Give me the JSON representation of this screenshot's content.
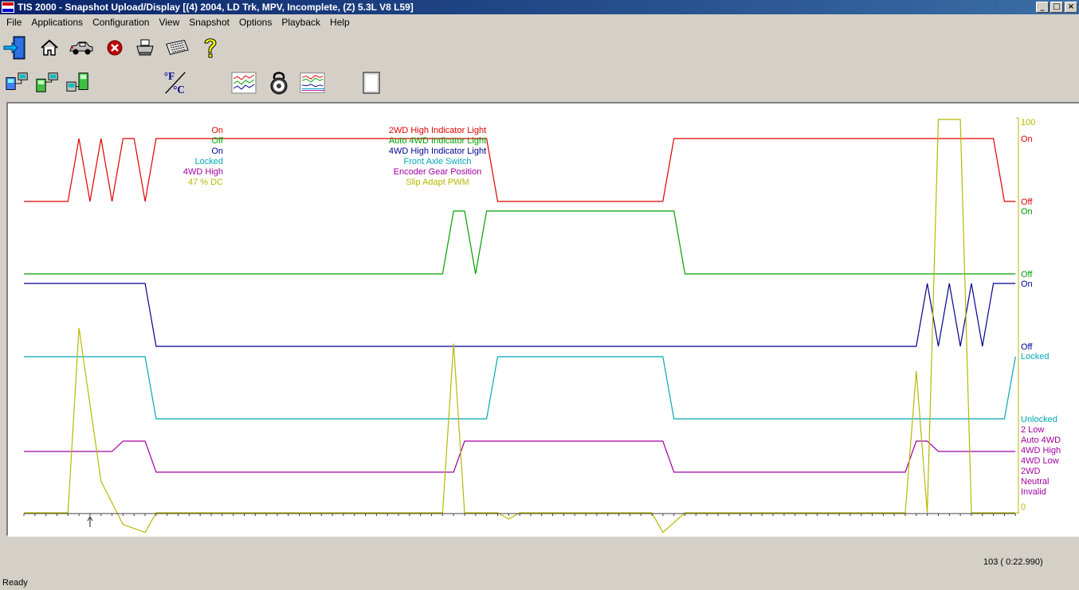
{
  "window": {
    "title": "TIS 2000 - Snapshot Upload/Display [(4) 2004, LD Trk, MPV, Incomplete, (Z) 5.3L   V8 L59]",
    "min_glyph": "_",
    "max_glyph": "□",
    "close_glyph": "×"
  },
  "menu": [
    "File",
    "Applications",
    "Configuration",
    "View",
    "Snapshot",
    "Options",
    "Playback",
    "Help"
  ],
  "toolbar_row1": [
    {
      "icon": "exit-door-icon"
    },
    {
      "icon": "home-icon"
    },
    {
      "icon": "vehicle-icon"
    },
    {
      "icon": "stop-icon"
    },
    {
      "icon": "print-icon"
    },
    {
      "icon": "keyboard-icon"
    },
    {
      "icon": "help-icon"
    }
  ],
  "toolbar_row2": [
    {
      "icon": "upload-device-icon"
    },
    {
      "icon": "transfer-device-icon"
    },
    {
      "icon": "download-device-icon"
    },
    {
      "icon": "unit-toggle-icon",
      "label_top": "°F",
      "label_bottom": "°C"
    },
    {
      "icon": "graph-icon"
    },
    {
      "icon": "lock-dial-icon"
    },
    {
      "icon": "graph-overlay-icon"
    },
    {
      "icon": "page-icon"
    }
  ],
  "colors": {
    "red": "#e00000",
    "green": "#00a000",
    "blue": "#000090",
    "cyan": "#00a8b8",
    "purple": "#a000a0",
    "olive": "#b8b800",
    "tick": "#404040"
  },
  "chart_data": {
    "type": "line",
    "x_samples": 46,
    "cursor_sample": 3,
    "current_values": [
      {
        "text": "On",
        "color": "red"
      },
      {
        "text": "Off",
        "color": "green"
      },
      {
        "text": "On",
        "color": "blue"
      },
      {
        "text": "Locked",
        "color": "cyan"
      },
      {
        "text": "4WD High",
        "color": "purple"
      },
      {
        "text": "47  % DC",
        "color": "olive"
      }
    ],
    "legend": [
      {
        "text": "2WD High Indicator Light",
        "color": "red"
      },
      {
        "text": "Auto 4WD Indicator Light",
        "color": "green"
      },
      {
        "text": "4WD High Indicator Light",
        "color": "blue"
      },
      {
        "text": "Front Axle Switch",
        "color": "cyan"
      },
      {
        "text": "Encoder Gear Position",
        "color": "purple"
      },
      {
        "text": "Slip Adapt PWM",
        "color": "olive"
      }
    ],
    "series": [
      {
        "name": "2WD High Indicator Light",
        "color": "red",
        "states": [
          "Off",
          "On"
        ],
        "points": [
          [
            0,
            0
          ],
          [
            2,
            0
          ],
          [
            2.5,
            1
          ],
          [
            3,
            0
          ],
          [
            3.5,
            1
          ],
          [
            4,
            0
          ],
          [
            4.5,
            1
          ],
          [
            5,
            1
          ],
          [
            5.5,
            0
          ],
          [
            6,
            1
          ],
          [
            21,
            1
          ],
          [
            21.5,
            0
          ],
          [
            29,
            0
          ],
          [
            29.5,
            1
          ],
          [
            44,
            1
          ],
          [
            44.5,
            0
          ],
          [
            45,
            0
          ]
        ]
      },
      {
        "name": "Auto 4WD Indicator Light",
        "color": "green",
        "states": [
          "Off",
          "On"
        ],
        "points": [
          [
            0,
            0
          ],
          [
            19,
            0
          ],
          [
            19.5,
            1
          ],
          [
            20,
            1
          ],
          [
            20.5,
            0
          ],
          [
            21,
            1
          ],
          [
            29.5,
            1
          ],
          [
            30,
            0
          ],
          [
            45,
            0
          ]
        ]
      },
      {
        "name": "4WD High Indicator Light",
        "color": "blue",
        "states": [
          "Off",
          "On"
        ],
        "points": [
          [
            0,
            1
          ],
          [
            5.5,
            1
          ],
          [
            6,
            0
          ],
          [
            40.5,
            0
          ],
          [
            41,
            1
          ],
          [
            41.5,
            0
          ],
          [
            42,
            1
          ],
          [
            42.5,
            0
          ],
          [
            43,
            1
          ],
          [
            43.5,
            0
          ],
          [
            44,
            1
          ],
          [
            45,
            1
          ]
        ]
      },
      {
        "name": "Front Axle Switch",
        "color": "cyan",
        "states": [
          "Unlocked",
          "Locked"
        ],
        "points": [
          [
            0,
            1
          ],
          [
            5.5,
            1
          ],
          [
            6,
            0
          ],
          [
            21,
            0
          ],
          [
            21.5,
            1
          ],
          [
            29,
            1
          ],
          [
            29.5,
            0
          ],
          [
            44.5,
            0
          ],
          [
            45,
            1
          ]
        ]
      },
      {
        "name": "Encoder Gear Position",
        "color": "purple",
        "states": [
          "Invalid",
          "Neutral",
          "2WD",
          "4WD Low",
          "4WD High",
          "Auto 4WD",
          "2 Low"
        ],
        "points": [
          [
            0,
            4
          ],
          [
            4,
            4
          ],
          [
            4.5,
            5
          ],
          [
            5.5,
            5
          ],
          [
            6,
            2
          ],
          [
            19.5,
            2
          ],
          [
            20,
            5
          ],
          [
            29,
            5
          ],
          [
            29.5,
            2
          ],
          [
            40,
            2
          ],
          [
            40.5,
            5
          ],
          [
            41,
            5
          ],
          [
            41.5,
            4
          ],
          [
            45,
            4
          ]
        ]
      },
      {
        "name": "Slip Adapt PWM",
        "color": "olive",
        "unit": "% DC",
        "ylim": [
          0,
          100
        ],
        "points": [
          [
            0,
            0
          ],
          [
            2,
            0
          ],
          [
            2.5,
            47
          ],
          [
            3.5,
            8
          ],
          [
            4.5,
            -3
          ],
          [
            5.5,
            -5
          ],
          [
            6,
            0
          ],
          [
            19,
            0
          ],
          [
            19.5,
            43
          ],
          [
            20,
            0
          ],
          [
            21.5,
            0
          ],
          [
            22,
            -1.6
          ],
          [
            22.5,
            0
          ],
          [
            28.5,
            0
          ],
          [
            29,
            -5
          ],
          [
            30,
            0
          ],
          [
            40,
            0
          ],
          [
            40.5,
            36
          ],
          [
            41,
            0
          ],
          [
            41.5,
            100
          ],
          [
            42.5,
            100
          ],
          [
            43,
            0
          ],
          [
            45,
            0
          ]
        ]
      }
    ],
    "right_axis_labels": [
      {
        "text": "100",
        "color": "olive",
        "row": 0
      },
      {
        "text": "On",
        "color": "red",
        "row": 1
      },
      {
        "text": "Off",
        "color": "red",
        "row": 2
      },
      {
        "text": "On",
        "color": "green",
        "row": 3
      },
      {
        "text": "Off",
        "color": "green",
        "row": 4
      },
      {
        "text": "On",
        "color": "blue",
        "row": 5
      },
      {
        "text": "Off",
        "color": "blue",
        "row": 6
      },
      {
        "text": "Locked",
        "color": "cyan",
        "row": 7
      },
      {
        "text": "Unlocked",
        "color": "cyan",
        "row": 8
      },
      {
        "text": "2 Low",
        "color": "purple",
        "row": 9
      },
      {
        "text": "Auto 4WD",
        "color": "purple",
        "row": 10
      },
      {
        "text": "4WD High",
        "color": "purple",
        "row": 11
      },
      {
        "text": "4WD Low",
        "color": "purple",
        "row": 12
      },
      {
        "text": "2WD",
        "color": "purple",
        "row": 13
      },
      {
        "text": "Neutral",
        "color": "purple",
        "row": 14
      },
      {
        "text": "Invalid",
        "color": "purple",
        "row": 15
      },
      {
        "text": "0",
        "color": "olive",
        "row": 16
      }
    ]
  },
  "status": {
    "position": "103 ( 0:22.990)",
    "ready": "Ready"
  }
}
